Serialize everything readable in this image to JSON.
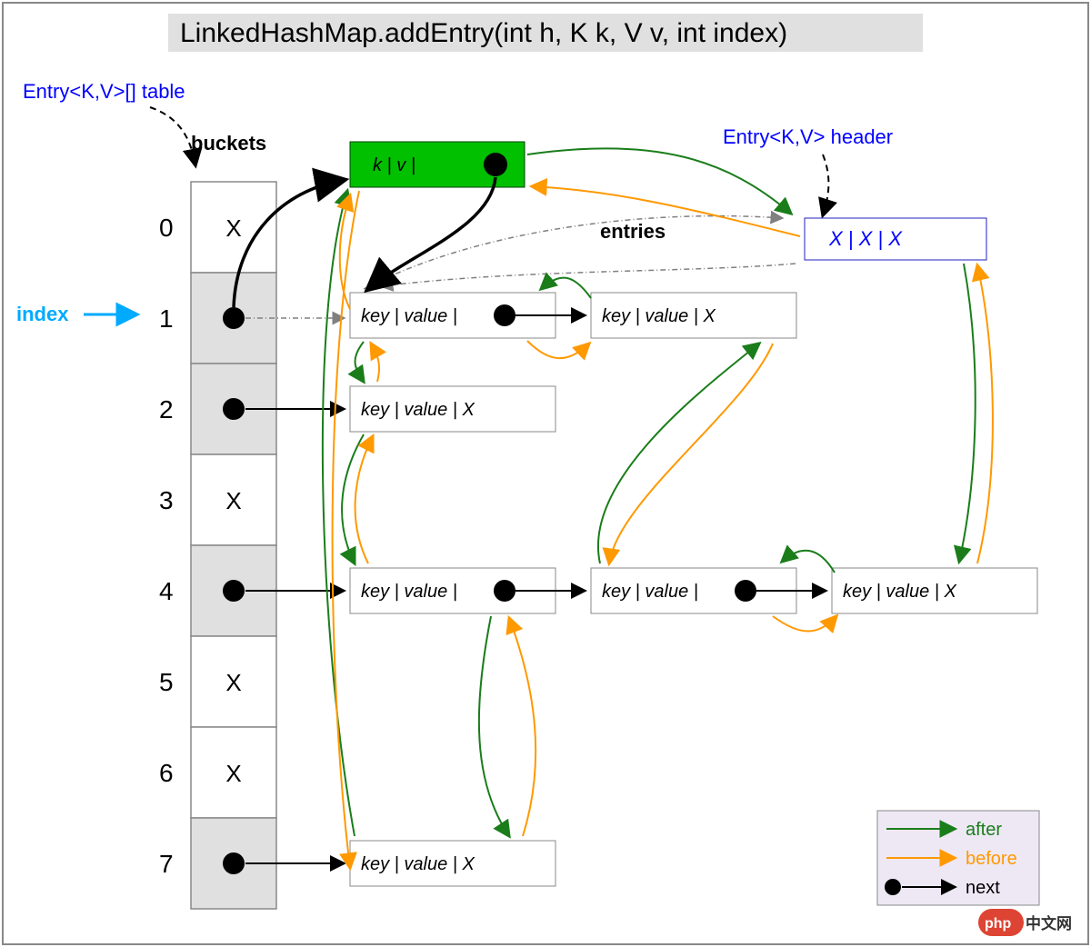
{
  "title": "LinkedHashMap.addEntry(int h, K k, V v, int index)",
  "labels": {
    "table_type": "Entry<K,V>[] table",
    "header_type": "Entry<K,V> header",
    "buckets": "buckets",
    "entries": "entries",
    "index": "index"
  },
  "bucket_indices": [
    "0",
    "1",
    "2",
    "3",
    "4",
    "5",
    "6",
    "7"
  ],
  "bucket_contents": [
    "X",
    "●",
    "●",
    "X",
    "●",
    "X",
    "X",
    "●"
  ],
  "selected_index": 1,
  "new_entry": "k  |  v  |",
  "header_entry": "X   |   X   |  X",
  "entry_label": "key | value |",
  "entry_label_null": "key | value |   X",
  "legend": {
    "after": "after",
    "before": "before",
    "next": "next"
  },
  "colors": {
    "after": "#1a7d1a",
    "before": "#ff9900",
    "next": "#000000",
    "index_arrow": "#00aaff",
    "new_entry_bg": "#00c000"
  },
  "watermark": "php中文网"
}
